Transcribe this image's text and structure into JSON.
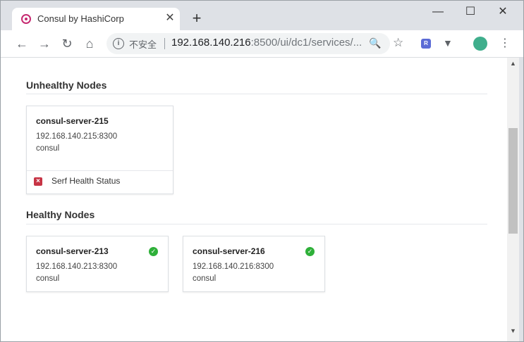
{
  "browser": {
    "tab_title": "Consul by HashiCorp",
    "tab_close": "✕",
    "new_tab": "+",
    "window_controls": {
      "minimize": "—",
      "maximize": "☐",
      "close": "✕"
    },
    "nav": {
      "back": "←",
      "forward": "→",
      "reload": "↻",
      "home": "⌂"
    },
    "security_label": "不安全",
    "url_host": "192.168.140.216",
    "url_rest": ":8500/ui/dc1/services/...",
    "icons": {
      "favicon": "consul-logo-icon",
      "info": "info-icon",
      "zoom": "zoom-icon",
      "star": "bookmark-star-icon",
      "ext1": "extension-r-icon",
      "ext2": "extension-v-icon",
      "profile": "profile-avatar-icon",
      "menu": "menu-dots-icon"
    },
    "ext1_letter": "R",
    "ext2_glyph": "▼",
    "zoom_glyph": "🔍",
    "star_glyph": "☆",
    "info_glyph": "i",
    "menu_glyph": "⋮"
  },
  "unhealthy": {
    "heading": "Unhealthy Nodes",
    "nodes": [
      {
        "name": "consul-server-215",
        "address": "192.168.140.215:8300",
        "datacenter": "consul",
        "failing_check": "Serf Health Status"
      }
    ]
  },
  "healthy": {
    "heading": "Healthy Nodes",
    "nodes": [
      {
        "name": "consul-server-213",
        "address": "192.168.140.213:8300",
        "datacenter": "consul"
      },
      {
        "name": "consul-server-216",
        "address": "192.168.140.216:8300",
        "datacenter": "consul"
      }
    ]
  },
  "colors": {
    "passing": "#2eb039",
    "critical": "#c73445"
  }
}
